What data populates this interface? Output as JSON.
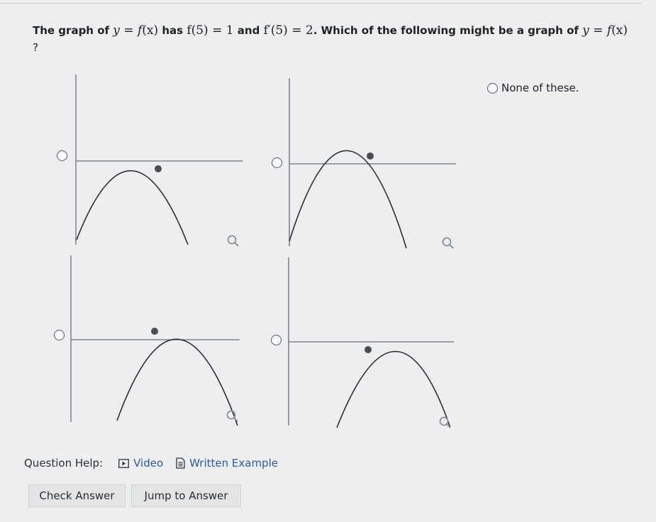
{
  "question": {
    "text_1": "The graph of",
    "text_2": "has",
    "text_3": "and",
    "text_4": ". Which of the following might be a graph of",
    "math_y": "y",
    "math_eq": " = ",
    "math_f": "f",
    "math_x": "(x)",
    "math_f5": "f(5) = 1",
    "math_fp5": "f′(5) = 2",
    "trailing": "?"
  },
  "options": {
    "none_label": "None of these."
  },
  "help": {
    "label": "Question Help:",
    "video": "Video",
    "written_example": "Written Example"
  },
  "buttons": {
    "check": "Check Answer",
    "jump": "Jump to Answer"
  },
  "colors": {
    "link": "#2d5b9a",
    "curve": "#2a2d31",
    "axis": "#6b7076"
  }
}
